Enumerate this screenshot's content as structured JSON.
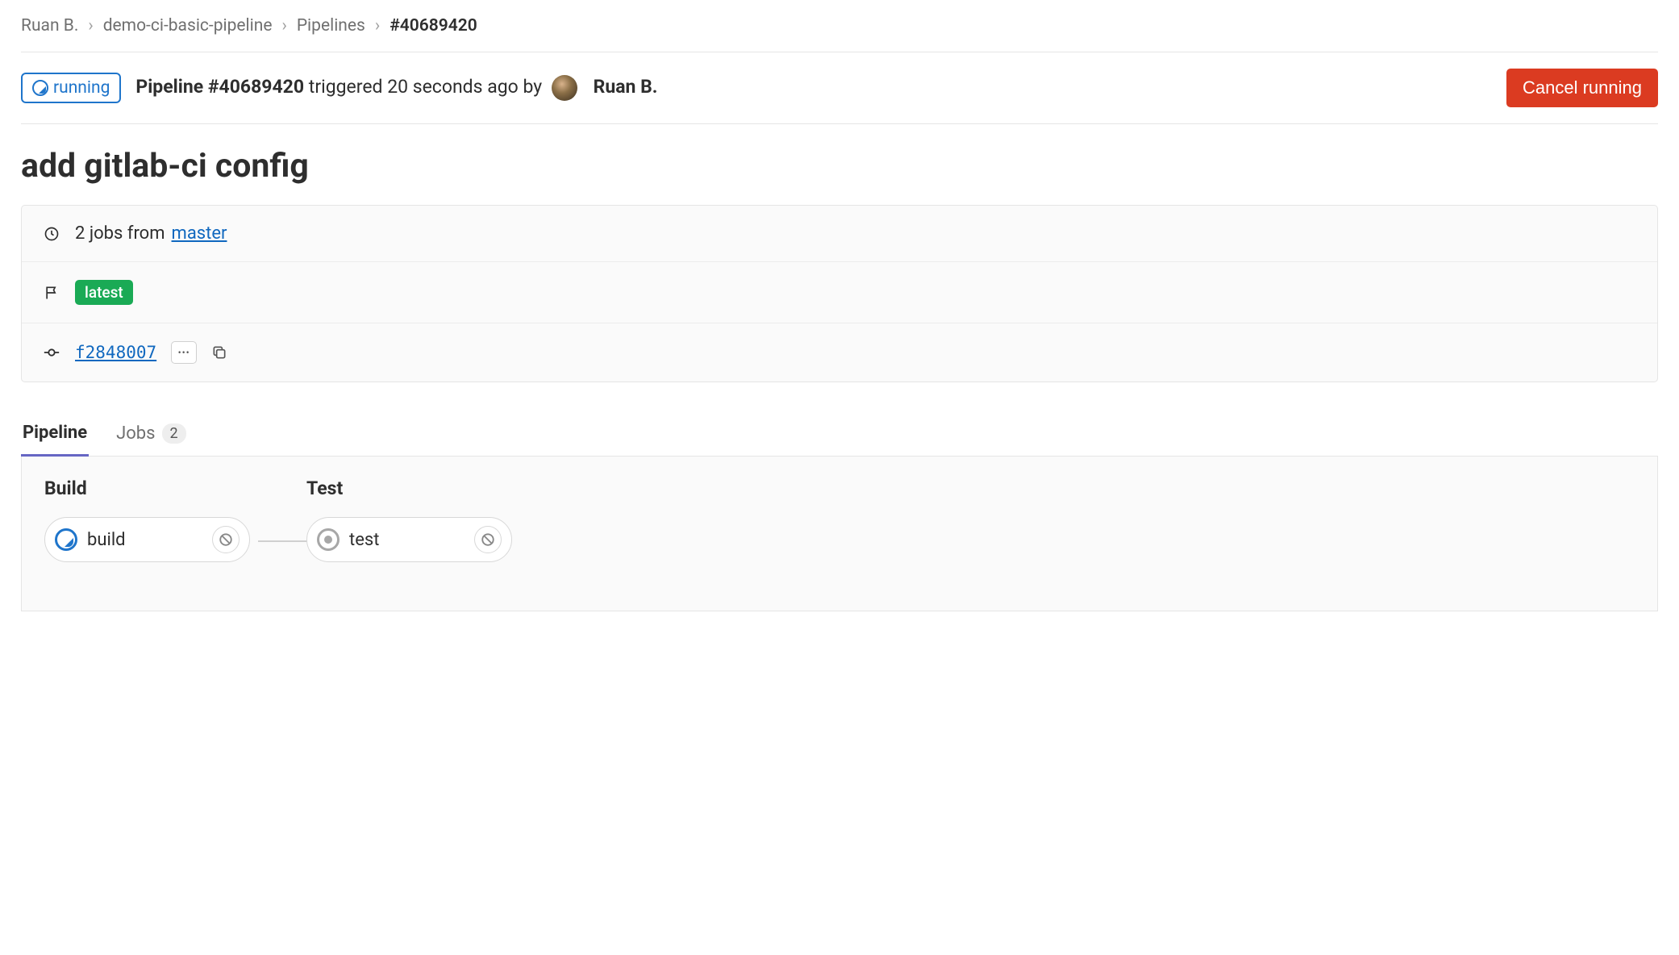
{
  "breadcrumb": {
    "owner": "Ruan B.",
    "project": "demo-ci-basic-pipeline",
    "section": "Pipelines",
    "current": "#40689420"
  },
  "header": {
    "status_label": "running",
    "pipeline_prefix": "Pipeline",
    "pipeline_id": "#40689420",
    "triggered_text": "triggered 20 seconds ago by",
    "user_name": "Ruan B.",
    "cancel_label": "Cancel running"
  },
  "title": "add gitlab-ci config",
  "info": {
    "jobs_text": "2 jobs from",
    "branch": "master",
    "tag": "latest",
    "commit_sha": "f2848007"
  },
  "tabs": {
    "pipeline": "Pipeline",
    "jobs": "Jobs",
    "jobs_count": "2"
  },
  "stages": [
    {
      "title": "Build",
      "job": {
        "name": "build",
        "status": "running"
      }
    },
    {
      "title": "Test",
      "job": {
        "name": "test",
        "status": "created"
      }
    }
  ]
}
